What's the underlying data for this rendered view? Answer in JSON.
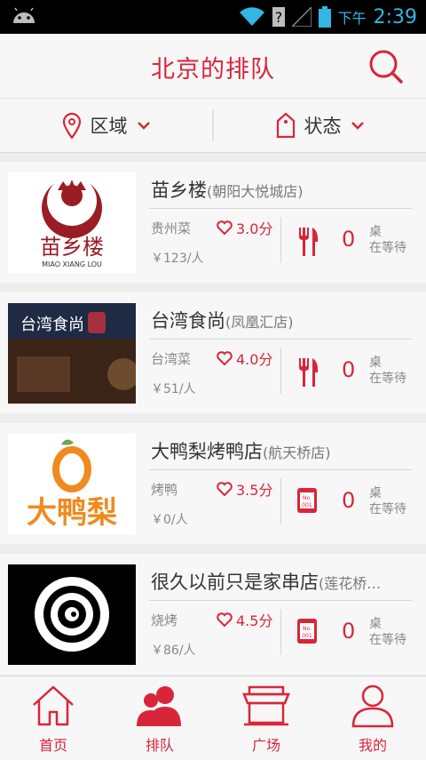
{
  "status_bar": {
    "ampm": "下午",
    "time": "2:39"
  },
  "header": {
    "title": "北京的排队"
  },
  "filters": {
    "area": "区域",
    "status": "状态"
  },
  "restaurants": [
    {
      "name": "苗乡楼",
      "branch": "(朝阳大悦城店)",
      "cuisine": "贵州菜",
      "rating": "3.0分",
      "price": "￥123/人",
      "count": "0",
      "unit": "桌",
      "wait": "在等待",
      "type": "dine-in",
      "logo_text": "苗乡楼",
      "logo_sub": "MIAO XIANG LOU"
    },
    {
      "name": "台湾食尚",
      "branch": "(凤凰汇店)",
      "cuisine": "台湾菜",
      "rating": "4.0分",
      "price": "￥51/人",
      "count": "0",
      "unit": "桌",
      "wait": "在等待",
      "type": "dine-in",
      "logo_text": "台湾食尚"
    },
    {
      "name": "大鸭梨烤鸭店",
      "branch": "(航天桥店)",
      "cuisine": "烤鸭",
      "rating": "3.5分",
      "price": "￥0/人",
      "count": "0",
      "unit": "桌",
      "wait": "在等待",
      "type": "ticket",
      "logo_text": "大鸭梨"
    },
    {
      "name": "很久以前只是家串店",
      "branch": "(莲花桥…",
      "cuisine": "烧烤",
      "rating": "4.5分",
      "price": "￥86/人",
      "count": "0",
      "unit": "桌",
      "wait": "在等待",
      "type": "ticket"
    }
  ],
  "tabs": [
    {
      "label": "首页",
      "icon": "home-icon"
    },
    {
      "label": "排队",
      "icon": "queue-icon"
    },
    {
      "label": "广场",
      "icon": "plaza-icon"
    },
    {
      "label": "我的",
      "icon": "profile-icon"
    }
  ],
  "colors": {
    "accent": "#d9253a",
    "background": "#ededed",
    "card": "#f7f7f7",
    "statusbar_text": "#33b5e5"
  }
}
